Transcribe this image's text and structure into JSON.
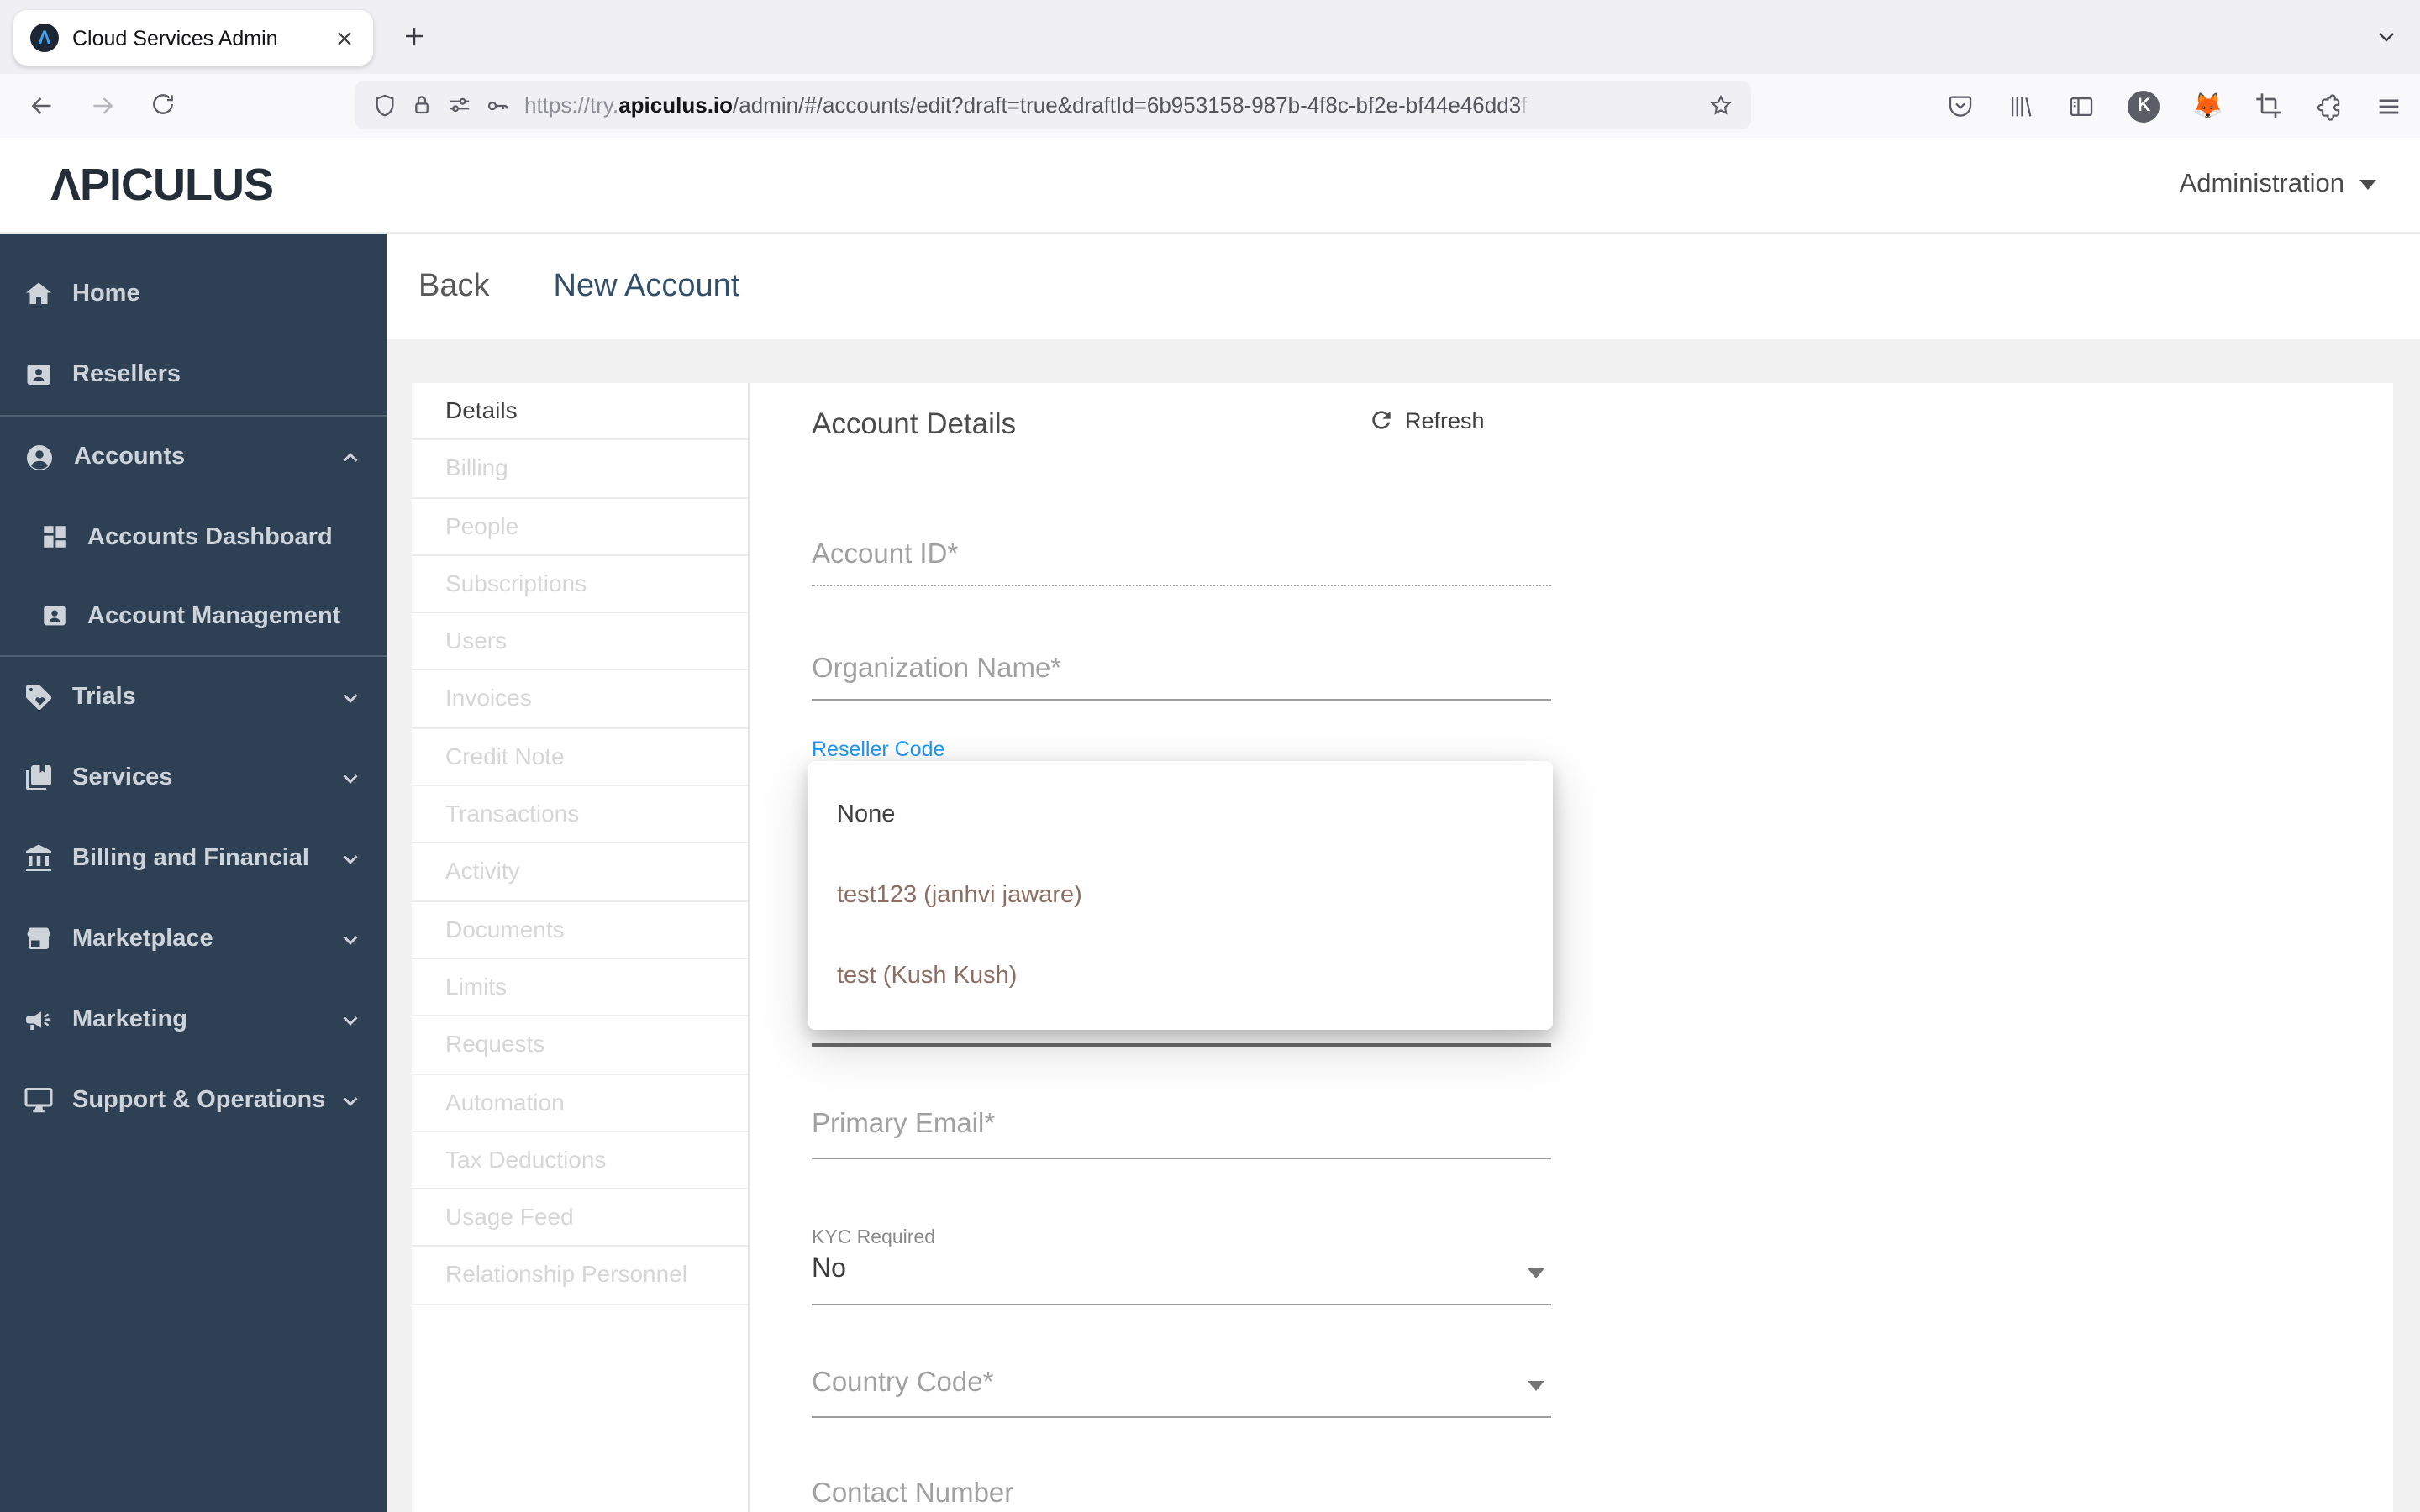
{
  "chrome": {
    "tab": {
      "title": "Cloud Services Admin"
    },
    "url": {
      "protocol": "https://try.",
      "domain": "apiculus.io",
      "path": "/admin/#/accounts/edit?draft=true&draftId=6b953158-987b-4f8c-bf2e-bf44e46dd3",
      "fade": "f"
    },
    "keeper_letter": "K",
    "metamask_glyph": "🦊"
  },
  "header": {
    "logo": "ΛPICULUS",
    "user_menu": "Administration"
  },
  "sidebar": {
    "items": [
      {
        "label": "Home"
      },
      {
        "label": "Resellers"
      },
      {
        "label": "Accounts",
        "expanded": true
      },
      {
        "label": "Accounts Dashboard"
      },
      {
        "label": "Account Management"
      },
      {
        "label": "Trials"
      },
      {
        "label": "Services"
      },
      {
        "label": "Billing and Financial"
      },
      {
        "label": "Marketplace"
      },
      {
        "label": "Marketing"
      },
      {
        "label": "Support & Operations"
      }
    ]
  },
  "page": {
    "back_label": "Back",
    "title": "New Account"
  },
  "subnav": {
    "items": [
      {
        "label": "Details",
        "active": true
      },
      {
        "label": "Billing"
      },
      {
        "label": "People"
      },
      {
        "label": "Subscriptions"
      },
      {
        "label": "Users"
      },
      {
        "label": "Invoices"
      },
      {
        "label": "Credit Note"
      },
      {
        "label": "Transactions"
      },
      {
        "label": "Activity"
      },
      {
        "label": "Documents"
      },
      {
        "label": "Limits"
      },
      {
        "label": "Requests"
      },
      {
        "label": "Automation"
      },
      {
        "label": "Tax Deductions"
      },
      {
        "label": "Usage Feed"
      },
      {
        "label": "Relationship Personnel"
      }
    ]
  },
  "form": {
    "section_title": "Account Details",
    "refresh_label": "Refresh",
    "fields": {
      "account_id": {
        "placeholder": "Account ID*"
      },
      "organization_name": {
        "placeholder": "Organization Name*"
      },
      "reseller_code": {
        "label": "Reseller Code"
      },
      "primary_email": {
        "placeholder": "Primary Email*"
      },
      "kyc_required": {
        "label": "KYC Required",
        "value": "No"
      },
      "country_code": {
        "placeholder": "Country Code*"
      },
      "contact_number": {
        "placeholder": "Contact Number"
      }
    }
  },
  "reseller_dropdown": {
    "options": [
      {
        "label": "None"
      },
      {
        "label": "test123 (janhvi jaware)"
      },
      {
        "label": "test (Kush Kush)"
      }
    ]
  },
  "colors": {
    "sidebar_bg": "#2e4154",
    "accent_navy": "#33506b",
    "link_blue": "#2196f3",
    "option_brown": "#8d6e63",
    "page_bg": "#f1f1f2",
    "favicon_blue": "#3ba3f8"
  }
}
